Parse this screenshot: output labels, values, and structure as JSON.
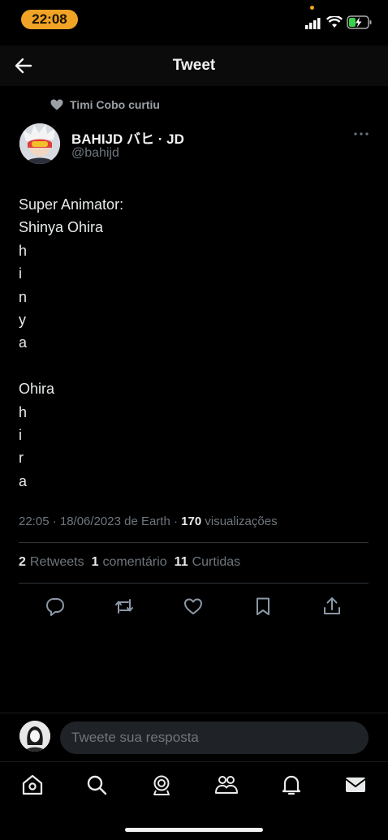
{
  "status_bar": {
    "time": "22:08"
  },
  "header": {
    "title": "Tweet"
  },
  "social_context": {
    "text": "Timi Cobo curtiu"
  },
  "author": {
    "display_name": "BAHIJD バヒ · JD",
    "handle": "@bahijd"
  },
  "tweet": {
    "lines": [
      "Super Animator:",
      "Shinya Ohira",
      "h",
      "i",
      "n",
      "y",
      "a",
      "",
      "Ohira",
      "h",
      "i",
      "r",
      "a"
    ],
    "timestamp": "22:05 · 18/06/2023 de Earth · ",
    "views_count": "170",
    "views_label": " visualizações"
  },
  "stats": {
    "retweets_count": "2",
    "retweets_label": "Retweets",
    "comments_count": "1",
    "comments_label": "comentário",
    "likes_count": "11",
    "likes_label": "Curtidas"
  },
  "reply": {
    "placeholder": "Tweete sua resposta"
  },
  "icons": {
    "back": "arrow-left-icon",
    "more": "more-horizontal-icon",
    "actions": [
      "reply-icon",
      "retweet-icon",
      "like-icon",
      "bookmark-icon",
      "share-icon"
    ],
    "nav": [
      "home-icon",
      "search-icon",
      "spaces-icon",
      "communities-icon",
      "notifications-icon",
      "messages-icon"
    ]
  },
  "colors": {
    "accent": "#f0a325",
    "background": "#000000",
    "secondary_text": "#6e767d"
  }
}
